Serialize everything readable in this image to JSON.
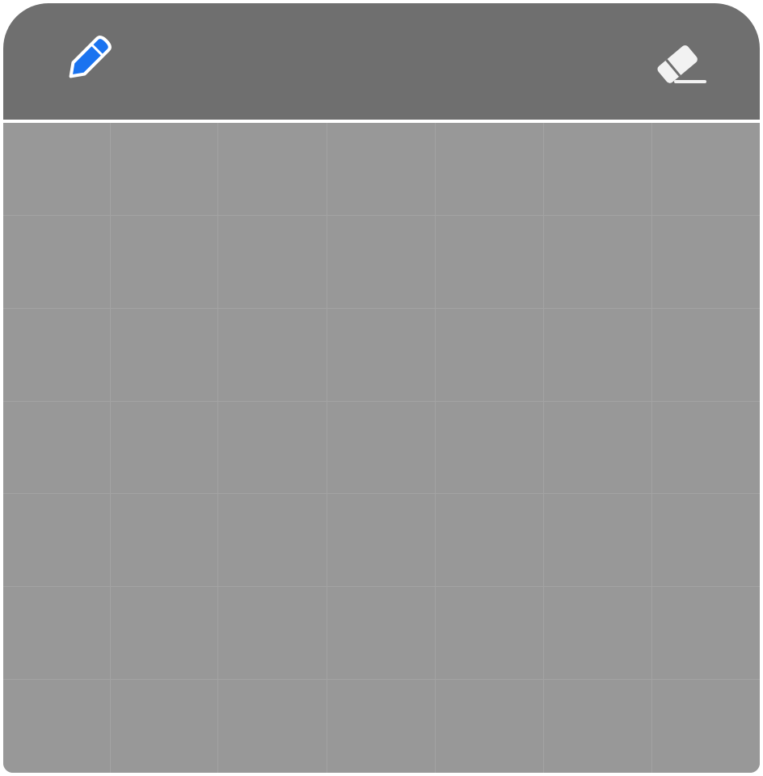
{
  "toolbar": {
    "tools": [
      {
        "name": "pencil-icon",
        "selected": true,
        "color": "#1a73f0"
      },
      {
        "name": "eraser-icon",
        "selected": false,
        "color": "#f2f2f2"
      }
    ]
  },
  "grid": {
    "rows": 7,
    "columns": 7,
    "cell_color": "#989898",
    "line_color": "#a3a3a3",
    "filled_cells": []
  },
  "colors": {
    "toolbar": "#6f6f6f",
    "canvas": "#989898",
    "accent": "#1a73f0"
  }
}
